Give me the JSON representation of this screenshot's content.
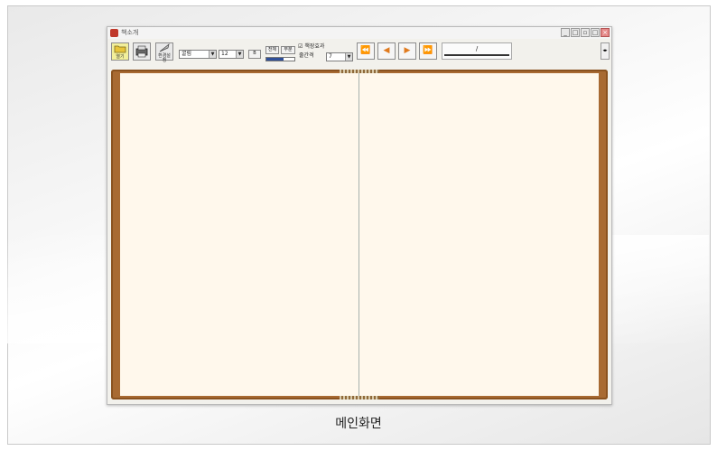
{
  "window": {
    "title": "책소개",
    "controls": [
      "_",
      "□",
      "▫",
      "□",
      "×"
    ]
  },
  "toolbar": {
    "open_label": "열기",
    "print_label": "",
    "settings_label": "환경설정",
    "font_select": "굴림",
    "size_select": "12",
    "bold_label": "B",
    "btn_a": "전체",
    "btn_b": "부분",
    "page_effect_label": "책장효과",
    "page_effect_checked": true,
    "spacing_label": "줄간격",
    "spacing_select": "7",
    "page_indicator": "/",
    "progress": 0.6
  },
  "caption": "메인화면"
}
